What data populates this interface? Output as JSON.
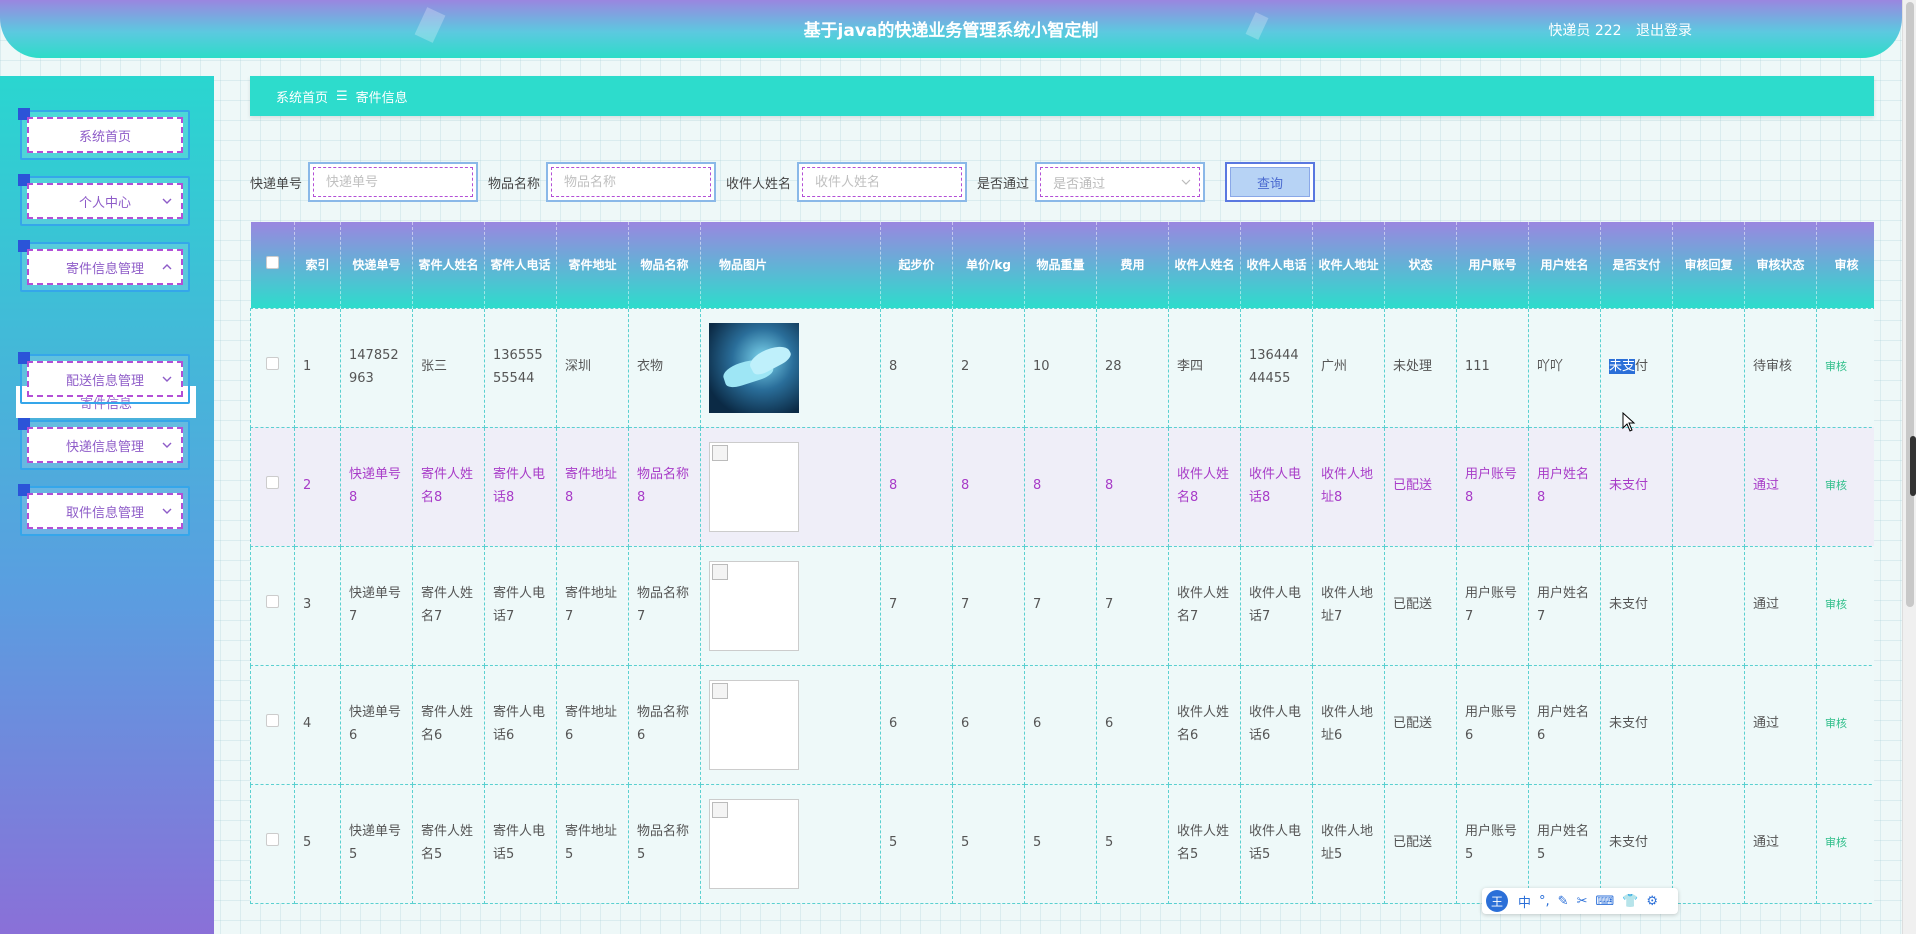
{
  "header": {
    "title": "基于java的快递业务管理系统小智定制",
    "user": "快递员 222",
    "logout": "退出登录"
  },
  "sidebar": {
    "items": [
      {
        "label": "系统首页",
        "has_chevron": false
      },
      {
        "label": "个人中心",
        "has_chevron": true
      },
      {
        "label": "寄件信息管理",
        "has_chevron": true,
        "expanded": true
      },
      {
        "label": "配送信息管理",
        "has_chevron": true
      },
      {
        "label": "快递信息管理",
        "has_chevron": true
      },
      {
        "label": "取件信息管理",
        "has_chevron": true
      }
    ],
    "submenu": "寄件信息"
  },
  "breadcrumb": {
    "home": "系统首页",
    "sep": "☰",
    "current": "寄件信息"
  },
  "search": {
    "tracking_label": "快递单号",
    "tracking_placeholder": "快递单号",
    "item_label": "物品名称",
    "item_placeholder": "物品名称",
    "receiver_label": "收件人姓名",
    "receiver_placeholder": "收件人姓名",
    "pass_label": "是否通过",
    "pass_placeholder": "是否通过",
    "query_button": "查询"
  },
  "table": {
    "headers": [
      "索引",
      "快递单号",
      "寄件人姓名",
      "寄件人电话",
      "寄件地址",
      "物品名称",
      "物品图片",
      "起步价",
      "单价/kg",
      "物品重量",
      "费用",
      "收件人姓名",
      "收件人电话",
      "收件人地址",
      "状态",
      "用户账号",
      "用户姓名",
      "是否支付",
      "审核回复",
      "审核状态",
      "审核"
    ],
    "audit_link": "审核",
    "rows": [
      {
        "idx": "1",
        "no": "147852963",
        "sname": "张三",
        "sphone": "13655555544",
        "saddr": "深圳",
        "item": "衣物",
        "img": "shoe",
        "base": "8",
        "unit": "2",
        "weight": "10",
        "fee": "28",
        "rname": "李四",
        "rphone": "13644444455",
        "raddr": "广州",
        "status": "未处理",
        "acct": "111",
        "uname": "吖吖",
        "paid": "未支付",
        "reply": "",
        "audit": "待审核"
      },
      {
        "idx": "2",
        "no": "快递单号8",
        "sname": "寄件人姓名8",
        "sphone": "寄件人电话8",
        "saddr": "寄件地址8",
        "item": "物品名称8",
        "img": "broken",
        "base": "8",
        "unit": "8",
        "weight": "8",
        "fee": "8",
        "rname": "收件人姓名8",
        "rphone": "收件人电话8",
        "raddr": "收件人地址8",
        "status": "已配送",
        "acct": "用户账号8",
        "uname": "用户姓名8",
        "paid": "未支付",
        "reply": "",
        "audit": "通过"
      },
      {
        "idx": "3",
        "no": "快递单号7",
        "sname": "寄件人姓名7",
        "sphone": "寄件人电话7",
        "saddr": "寄件地址7",
        "item": "物品名称7",
        "img": "broken",
        "base": "7",
        "unit": "7",
        "weight": "7",
        "fee": "7",
        "rname": "收件人姓名7",
        "rphone": "收件人电话7",
        "raddr": "收件人地址7",
        "status": "已配送",
        "acct": "用户账号7",
        "uname": "用户姓名7",
        "paid": "未支付",
        "reply": "",
        "audit": "通过"
      },
      {
        "idx": "4",
        "no": "快递单号6",
        "sname": "寄件人姓名6",
        "sphone": "寄件人电话6",
        "saddr": "寄件地址6",
        "item": "物品名称6",
        "img": "broken",
        "base": "6",
        "unit": "6",
        "weight": "6",
        "fee": "6",
        "rname": "收件人姓名6",
        "rphone": "收件人电话6",
        "raddr": "收件人地址6",
        "status": "已配送",
        "acct": "用户账号6",
        "uname": "用户姓名6",
        "paid": "未支付",
        "reply": "",
        "audit": "通过"
      },
      {
        "idx": "5",
        "no": "快递单号5",
        "sname": "寄件人姓名5",
        "sphone": "寄件人电话5",
        "saddr": "寄件地址5",
        "item": "物品名称5",
        "img": "broken",
        "base": "5",
        "unit": "5",
        "weight": "5",
        "fee": "5",
        "rname": "收件人姓名5",
        "rphone": "收件人电话5",
        "raddr": "收件人地址5",
        "status": "已配送",
        "acct": "用户账号5",
        "uname": "用户姓名5",
        "paid": "未支付",
        "reply": "",
        "audit": "通过"
      }
    ]
  },
  "ime_toolbar": {
    "logo": "王",
    "items": [
      "中",
      "°,",
      "✎",
      "✂",
      "⌨",
      "👕",
      "⚙"
    ]
  },
  "colors": {
    "accent": "#2ddccc",
    "purple": "#9a86e0",
    "highlight_text": "#a83cc8"
  }
}
